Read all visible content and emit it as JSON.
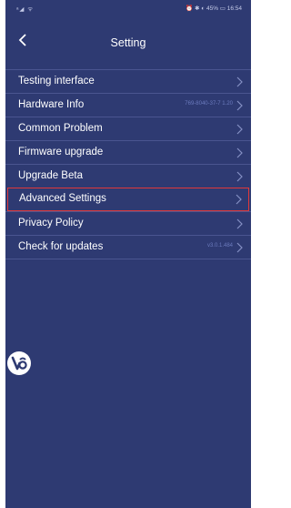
{
  "status_bar": {
    "left": "ᵃ◢ ᯤ",
    "right": "⏰ ✱ ◐ 45% ▭ 16:54"
  },
  "header": {
    "title": "Setting",
    "back_icon": "chevron-left-icon"
  },
  "menu": [
    {
      "label": "Testing interface",
      "value": ""
    },
    {
      "label": "Hardware Info",
      "value": "769-8040-37-7 1.20"
    },
    {
      "label": "Common Problem",
      "value": ""
    },
    {
      "label": "Firmware upgrade",
      "value": ""
    },
    {
      "label": "Upgrade Beta",
      "value": ""
    },
    {
      "label": "Advanced Settings",
      "value": "",
      "highlighted": true
    },
    {
      "label": "Privacy Policy",
      "value": ""
    },
    {
      "label": "Check for updates",
      "value": "v3.0.1.484"
    }
  ],
  "colors": {
    "background": "#2e3a72",
    "divider": "#4a5590",
    "highlight": "#e0393a",
    "muted_text": "#6b7abd"
  },
  "floating_icon": "app-logo-icon"
}
